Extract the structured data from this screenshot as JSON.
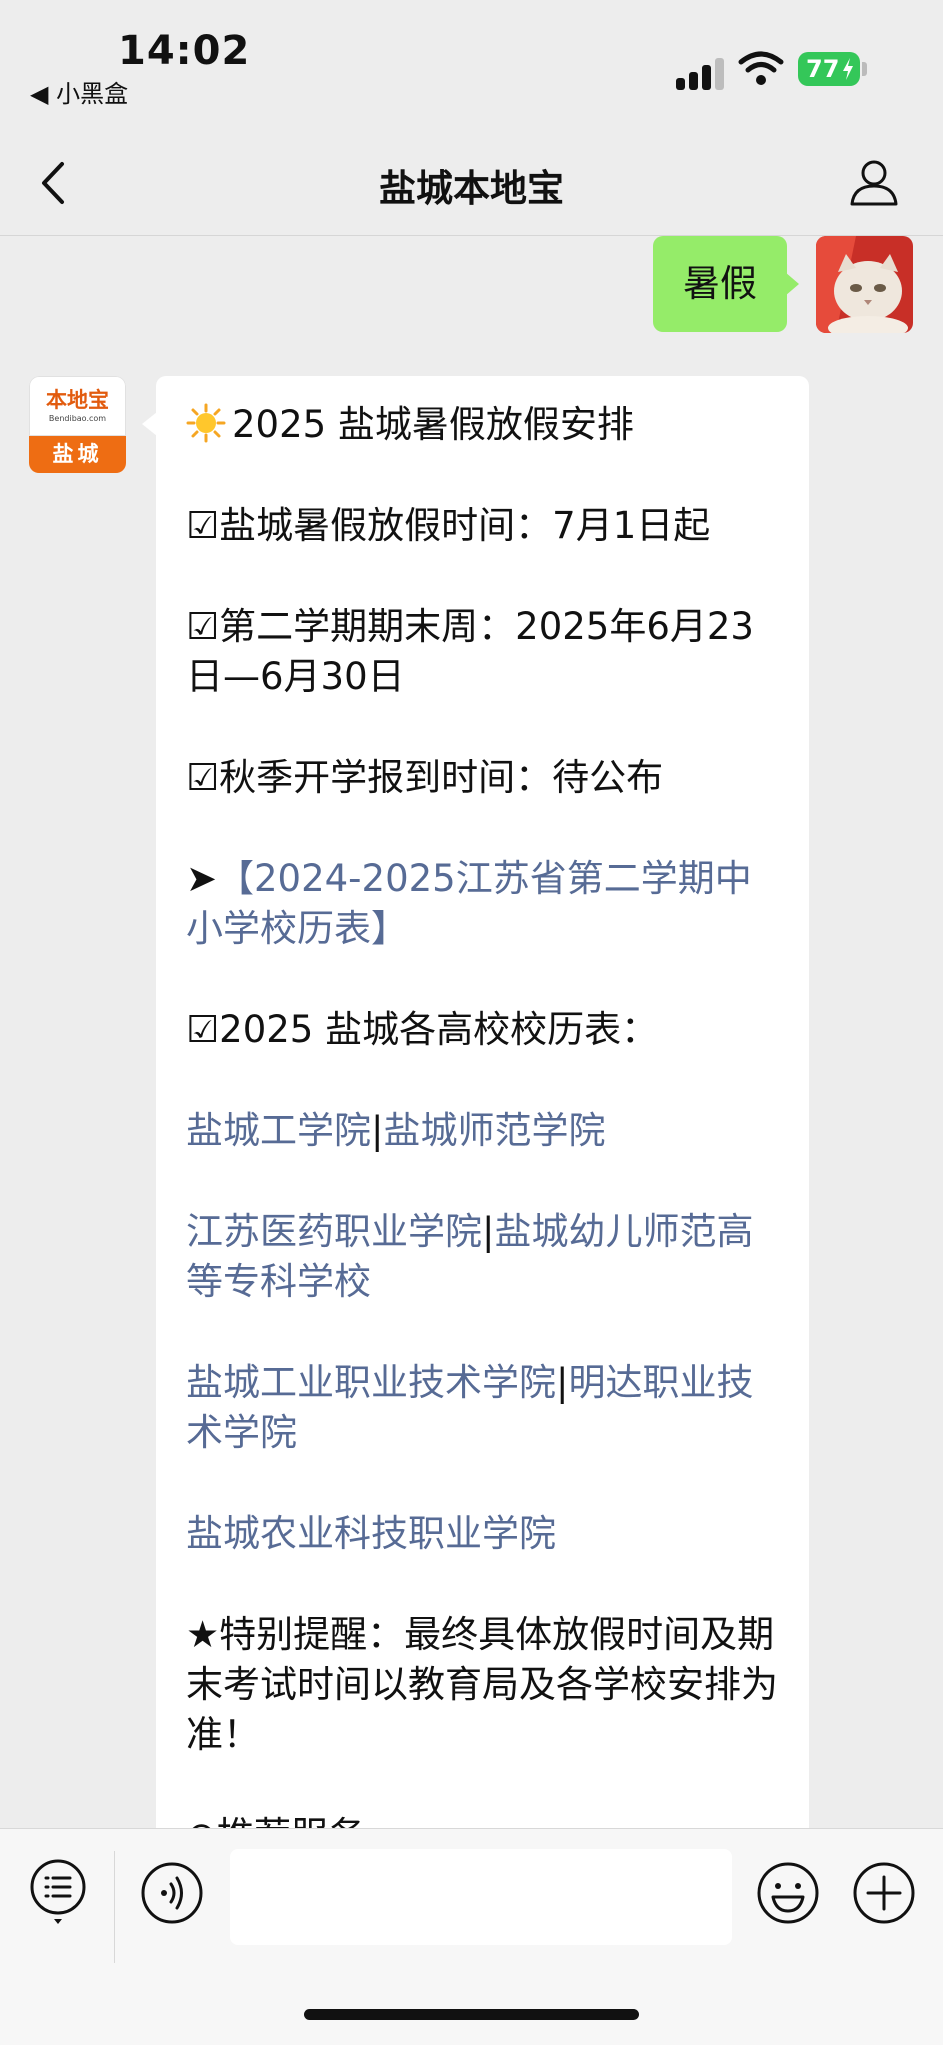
{
  "status": {
    "time": "14:02",
    "back_app": "◀ 小黑盒",
    "battery": "77"
  },
  "nav": {
    "title": "盐城本地宝"
  },
  "chat": {
    "sent_message": "暑假",
    "bot_avatar": {
      "brand": "本地宝",
      "domain": "Bendibao.com",
      "city": "盐城"
    },
    "reply": {
      "title": "2025 盐城暑假放假安排",
      "line1": "☑盐城暑假放假时间：7月1日起",
      "line2": "☑第二学期期末周：2025年6月23日—6月30日",
      "line3": "☑秋季开学报到时间：待公布",
      "arrow": "➤",
      "link_calendar": "【2024-2025江苏省第二学期中小学校历表】",
      "colleges_heading": "☑2025 盐城各高校校历表：",
      "sep": "|",
      "college1": "盐城工学院",
      "college2": "盐城师范学院",
      "college3": "江苏医药职业学院",
      "college4": "盐城幼儿师范高等专科学校",
      "college5": "盐城工业职业技术学院",
      "college6": "明达职业技术学院",
      "college7": "盐城农业科技职业学院",
      "reminder": "★特别提醒：最终具体放假时间及期末考试时间以教育局及各学校安排为准！",
      "cut_off": "⊙推荐服务"
    }
  },
  "bottom": {
    "input_value": ""
  }
}
